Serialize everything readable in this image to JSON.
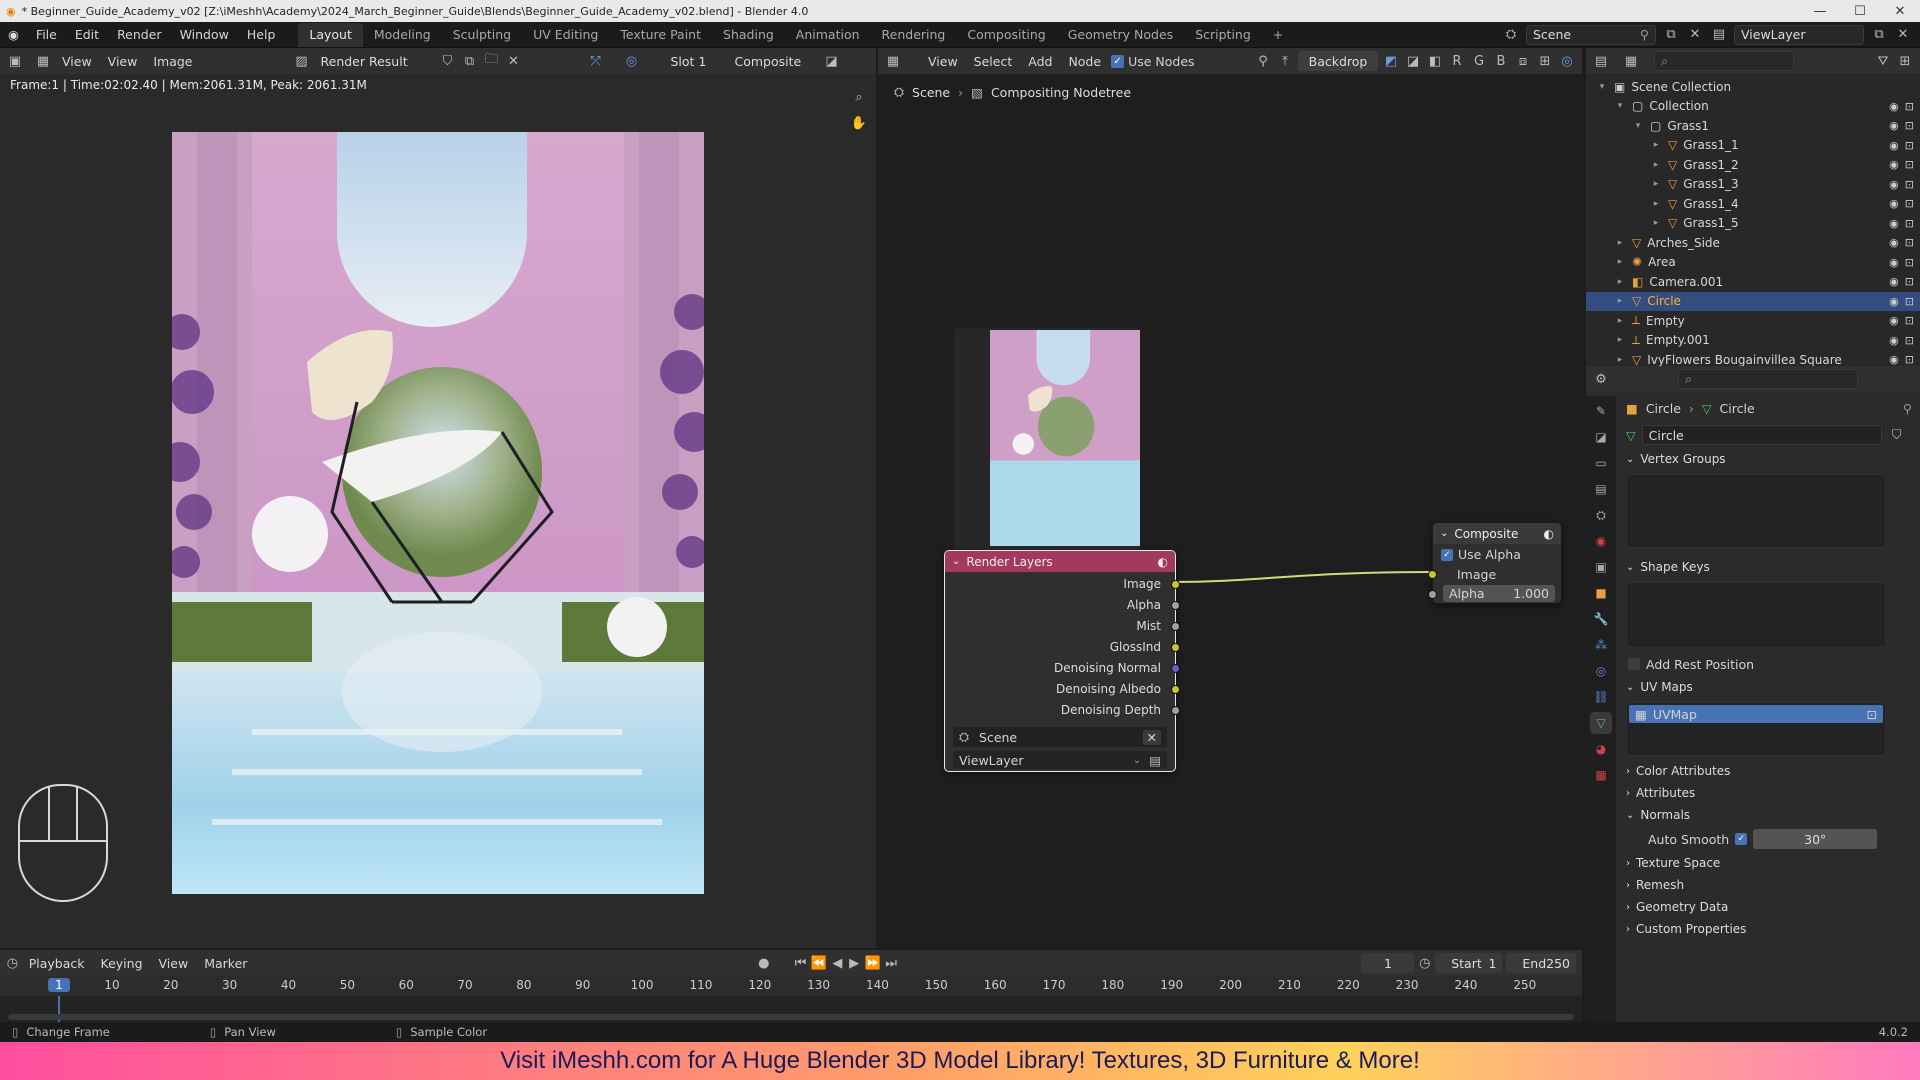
{
  "window": {
    "title": "* Beginner_Guide_Academy_v02 [Z:\\iMeshh\\Academy\\2024_March_Beginner_Guide\\Blends\\Beginner_Guide_Academy_v02.blend] - Blender 4.0"
  },
  "menu": [
    "File",
    "Edit",
    "Render",
    "Window",
    "Help"
  ],
  "workspaces": [
    "Layout",
    "Modeling",
    "Sculpting",
    "UV Editing",
    "Texture Paint",
    "Shading",
    "Animation",
    "Rendering",
    "Compositing",
    "Geometry Nodes",
    "Scripting"
  ],
  "active_workspace": "Layout",
  "scene_field": "Scene",
  "viewlayer_field": "ViewLayer",
  "image_editor": {
    "menus": [
      "View",
      "Image"
    ],
    "view_label": "View",
    "image_name": "Render Result",
    "slot": "Slot 1",
    "pass": "Composite",
    "stats": "Frame:1 | Time:02:02.40 | Mem:2061.31M, Peak: 2061.31M"
  },
  "node_editor": {
    "menus": [
      "View",
      "Select",
      "Add",
      "Node"
    ],
    "use_nodes": "Use Nodes",
    "backdrop": "Backdrop",
    "channels": [
      "R",
      "G",
      "B"
    ],
    "breadcrumb": [
      "Scene",
      "Compositing Nodetree"
    ],
    "render_layers": {
      "title": "Render Layers",
      "outputs": [
        "Image",
        "Alpha",
        "Mist",
        "GlossInd",
        "Denoising Normal",
        "Denoising Albedo",
        "Denoising Depth"
      ],
      "scene": "Scene",
      "layer": "ViewLayer"
    },
    "composite": {
      "title": "Composite",
      "use_alpha": "Use Alpha",
      "input": "Image",
      "alpha_label": "Alpha",
      "alpha_value": "1.000"
    }
  },
  "outliner": {
    "rows": [
      {
        "label": "Scene Collection",
        "icon": "scene-collection-icon",
        "selected": false
      },
      {
        "label": "Collection",
        "icon": "collection-icon",
        "selected": false
      },
      {
        "label": "Grass1",
        "icon": "collection-icon",
        "selected": false
      },
      {
        "label": "Grass1_1",
        "icon": "mesh-icon",
        "selected": false
      },
      {
        "label": "Grass1_2",
        "icon": "mesh-icon",
        "selected": false
      },
      {
        "label": "Grass1_3",
        "icon": "mesh-icon",
        "selected": false
      },
      {
        "label": "Grass1_4",
        "icon": "mesh-icon",
        "selected": false
      },
      {
        "label": "Grass1_5",
        "icon": "mesh-icon",
        "selected": false
      },
      {
        "label": "Arches_Side",
        "icon": "mesh-icon",
        "selected": false
      },
      {
        "label": "Area",
        "icon": "light-icon",
        "selected": false
      },
      {
        "label": "Camera.001",
        "icon": "camera-icon",
        "selected": false
      },
      {
        "label": "Circle",
        "icon": "mesh-icon",
        "selected": true
      },
      {
        "label": "Empty",
        "icon": "empty-icon",
        "selected": false
      },
      {
        "label": "Empty.001",
        "icon": "empty-icon",
        "selected": false
      },
      {
        "label": "IvyFlowers Bougainvillea Square",
        "icon": "mesh-icon",
        "selected": false
      }
    ]
  },
  "properties": {
    "breadcrumb": [
      "Circle",
      "Circle"
    ],
    "datablock": "Circle",
    "panels": {
      "vertex_groups": "Vertex Groups",
      "shape_keys": "Shape Keys",
      "add_rest_position": "Add Rest Position",
      "uv_maps": "UV Maps",
      "uvmap": "UVMap",
      "color_attributes": "Color Attributes",
      "attributes": "Attributes",
      "normals": "Normals",
      "auto_smooth": "Auto Smooth",
      "auto_smooth_angle": "30°",
      "texture_space": "Texture Space",
      "remesh": "Remesh",
      "geometry_data": "Geometry Data",
      "custom_properties": "Custom Properties"
    }
  },
  "timeline": {
    "menus": [
      "Playback",
      "Keying",
      "View",
      "Marker"
    ],
    "current_frame": "1",
    "start_label": "Start",
    "start": "1",
    "end_label": "End",
    "end": "250",
    "ruler": [
      "1",
      "10",
      "20",
      "30",
      "40",
      "50",
      "60",
      "70",
      "80",
      "90",
      "100",
      "110",
      "120",
      "130",
      "140",
      "150",
      "160",
      "170",
      "180",
      "190",
      "200",
      "210",
      "220",
      "230",
      "240",
      "250"
    ]
  },
  "status": {
    "items": [
      "Change Frame",
      "Pan View",
      "Sample Color"
    ],
    "version": "4.0.2"
  },
  "banner": "Visit iMeshh.com for A Huge Blender 3D Model Library! Textures, 3D Furniture & More!",
  "colors": {
    "accent": "#4772b3",
    "selected_row": "#334d80",
    "render_layers_header": "#a33a5c",
    "composite_header": "#3a3a3a",
    "socket_yellow": "#c7c729",
    "socket_gray": "#a1a1a1",
    "socket_purple": "#6363c7"
  }
}
